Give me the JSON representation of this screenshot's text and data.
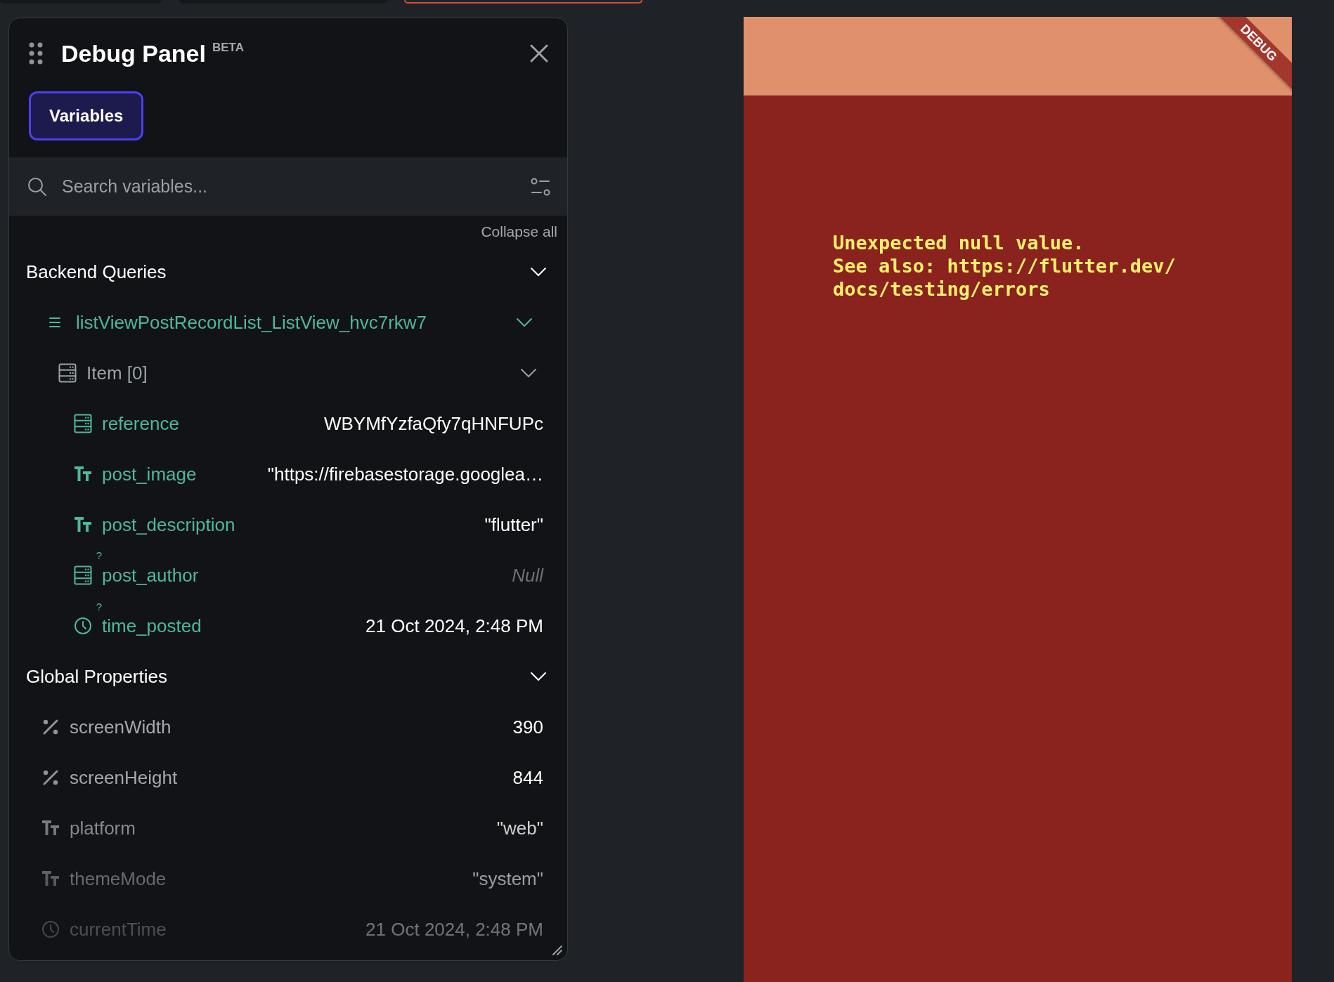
{
  "top_tabs": [
    {
      "kind": "plain"
    },
    {
      "kind": "plain"
    },
    {
      "kind": "alert"
    }
  ],
  "panel": {
    "title": "Debug Panel",
    "badge": "BETA",
    "tabs": [
      {
        "label": "Variables",
        "selected": true
      }
    ],
    "search": {
      "placeholder": "Search variables..."
    },
    "collapse_all": "Collapse all",
    "sections": [
      {
        "kind": "backend",
        "title": "Backend Queries",
        "expanded": true,
        "children": [
          {
            "kind": "list",
            "name": "listViewPostRecordList_ListView_hvc7rkw7",
            "expanded": true,
            "children": [
              {
                "kind": "item",
                "name": "Item [0]",
                "expanded": true,
                "children": [
                  {
                    "kind": "document",
                    "name": "reference",
                    "value": "WBYMfYzfaQfy7qHNFUPc",
                    "null": false
                  },
                  {
                    "kind": "text",
                    "name": "post_image",
                    "value": "\"https://firebasestorage.googlea…",
                    "null": false
                  },
                  {
                    "kind": "text",
                    "name": "post_description",
                    "value": "\"flutter\"",
                    "null": false
                  },
                  {
                    "kind": "document",
                    "name": "post_author",
                    "optional_mark": "?",
                    "value": "Null",
                    "null": true
                  },
                  {
                    "kind": "time",
                    "name": "time_posted",
                    "optional_mark": "?",
                    "value": "21 Oct 2024, 2:48 PM",
                    "null": false
                  }
                ]
              }
            ]
          }
        ]
      },
      {
        "kind": "global",
        "title": "Global Properties",
        "expanded": true,
        "children": [
          {
            "kind": "number",
            "name": "screenWidth",
            "value": "390",
            "null": false
          },
          {
            "kind": "number",
            "name": "screenHeight",
            "value": "844",
            "null": false
          },
          {
            "kind": "text",
            "name": "platform",
            "value": "\"web\"",
            "null": false
          },
          {
            "kind": "text",
            "name": "themeMode",
            "value": "\"system\"",
            "null": false
          },
          {
            "kind": "time",
            "name": "currentTime",
            "value": "21 Oct 2024, 2:48 PM",
            "null": false
          }
        ]
      }
    ]
  },
  "preview": {
    "banner": "DEBUG",
    "error_lines": [
      "Unexpected null value.",
      "See also: https://flutter.dev/",
      "docs/testing/errors"
    ]
  }
}
